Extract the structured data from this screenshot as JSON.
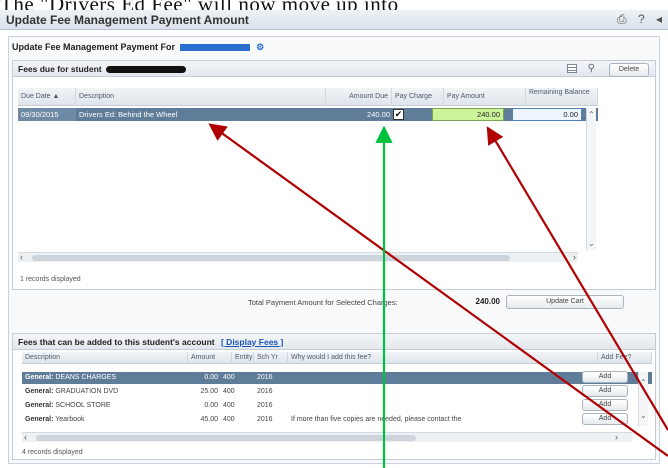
{
  "caption": "The \"Drivers Ed Fee\" will now move up into",
  "window": {
    "title": "Update Fee Management Payment Amount",
    "tools": [
      "⎙",
      "?",
      "◂"
    ]
  },
  "heading": {
    "label": "Update Fee Management Payment For"
  },
  "fees_due": {
    "title": "Fees due for student",
    "delete_label": "Delete",
    "columns": [
      "Due Date ▲",
      "Description",
      "Amount Due",
      "Pay Charge",
      "Pay Amount",
      "Remaining Balance"
    ],
    "row": {
      "due_date": "09/30/2015",
      "description": "Drivers Ed: Behind the Wheel",
      "amount_due": "240.00",
      "pay_charge_checked": true,
      "pay_amount": "240.00",
      "remaining": "0.00"
    },
    "records": "1 records displayed",
    "total_label": "Total Payment Amount for Selected Charges:",
    "total_value": "240.00",
    "update_cart": "Update Cart"
  },
  "fees_add": {
    "title": "Fees that can be added to this student's account",
    "display_fees": "[ Display Fees ]",
    "columns": [
      "Description",
      "Amount",
      "Entity",
      "Sch Yr",
      "Why would I add this fee?",
      "Add Fee?"
    ],
    "rows": [
      {
        "category": "General:",
        "name": "DEANS CHARGES",
        "amount": "0.00",
        "entity": "400",
        "year": "2016",
        "why": "",
        "add": "Add"
      },
      {
        "category": "General:",
        "name": "GRADUATION DVD",
        "amount": "25.00",
        "entity": "400",
        "year": "2016",
        "why": "",
        "add": "Add"
      },
      {
        "category": "General:",
        "name": "SCHOOL STORE",
        "amount": "0.00",
        "entity": "400",
        "year": "2016",
        "why": "",
        "add": "Add"
      },
      {
        "category": "General:",
        "name": "Yearbook",
        "amount": "45.00",
        "entity": "400",
        "year": "2016",
        "why": "If more than five copies are needed, please contact the",
        "add": "Add"
      }
    ],
    "records": "4 records displayed"
  },
  "colors": {
    "selected_row": "#5f7d99",
    "pay_amount_bg": "#ccf59a",
    "arrow_red": "#b00000",
    "arrow_green": "#00c040"
  }
}
